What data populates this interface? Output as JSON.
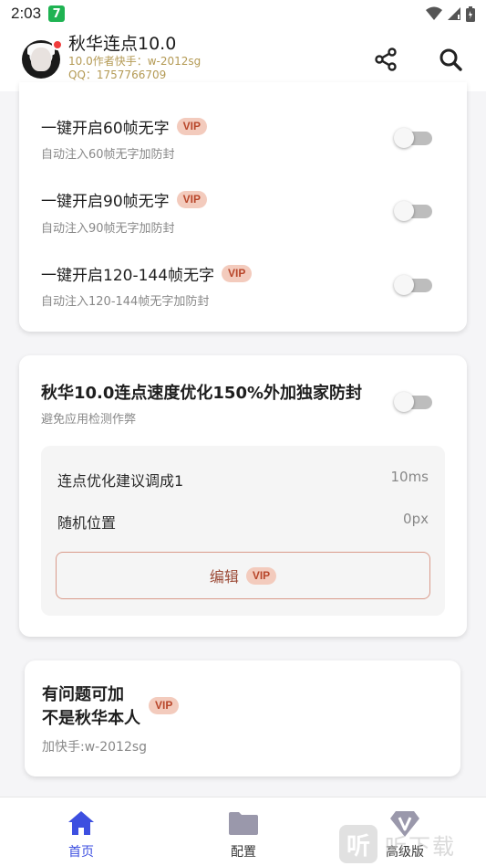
{
  "status_bar": {
    "time": "2:03",
    "app_badge": "7"
  },
  "header": {
    "title": "秋华连点10.0",
    "subtitle_1": "10.0作者快手：w-2012sg",
    "subtitle_2": "QQ：1757766709"
  },
  "card1": {
    "rows": [
      {
        "title": "一键开启60帧无字",
        "badge": "VIP",
        "desc": "自动注入60帧无字加防封",
        "enabled": false
      },
      {
        "title": "一键开启90帧无字",
        "badge": "VIP",
        "desc": "自动注入90帧无字加防封",
        "enabled": false
      },
      {
        "title": "一键开启120-144帧无字",
        "badge": "VIP",
        "desc": "自动注入120-144帧无字加防封",
        "enabled": false
      }
    ]
  },
  "card2": {
    "title": "秋华10.0连点速度优化150%外加独家防封",
    "desc": "避免应用检测作弊",
    "enabled": false,
    "settings": [
      {
        "label": "连点优化建议调成1",
        "value": "10ms"
      },
      {
        "label": "随机位置",
        "value": "0px"
      }
    ],
    "edit_label": "编辑",
    "edit_badge": "VIP"
  },
  "card3": {
    "title_line1": "有问题可加",
    "title_line2": "不是秋华本人",
    "badge": "VIP",
    "desc": "加快手:w-2012sg"
  },
  "bottom_nav": {
    "items": [
      {
        "label": "首页",
        "icon": "home-icon",
        "active": true
      },
      {
        "label": "配置",
        "icon": "folder-icon",
        "active": false
      },
      {
        "label": "高级版",
        "icon": "diamond-v-icon",
        "active": false
      }
    ]
  },
  "watermark": {
    "glyph": "听",
    "text": "听下载"
  },
  "colors": {
    "accent": "#3d4fe0",
    "vip_bg": "#f3cbbd",
    "vip_text": "#b8462a",
    "subtitle_gold": "#b49a55"
  }
}
